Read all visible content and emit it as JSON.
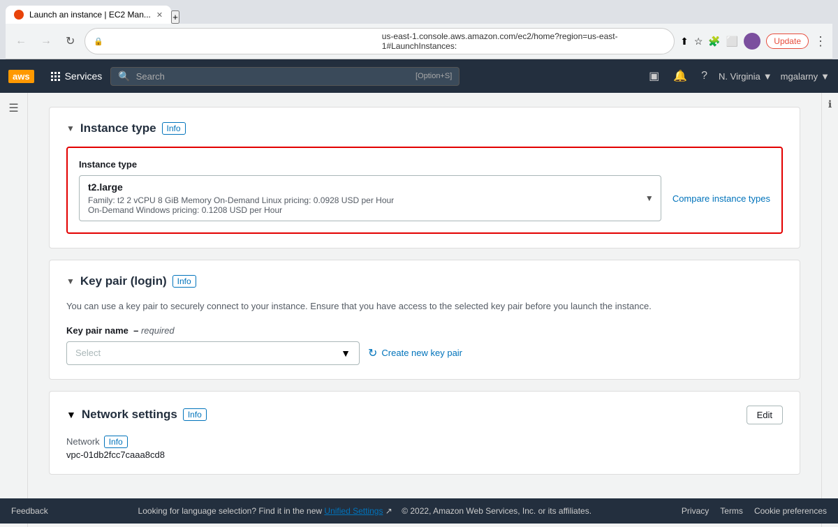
{
  "browser": {
    "tab_title": "Launch an instance | EC2 Man...",
    "new_tab_icon": "+",
    "address": "us-east-1.console.aws.amazon.com/ec2/home?region=us-east-1#LaunchInstances:",
    "update_label": "Update"
  },
  "aws_nav": {
    "logo": "aws",
    "services_label": "Services",
    "search_placeholder": "Search",
    "search_shortcut": "[Option+S]",
    "region": "N. Virginia",
    "user": "mgalarny"
  },
  "instance_type_section": {
    "title": "Instance type",
    "info_label": "Info",
    "field_label": "Instance type",
    "selected_instance": "t2.large",
    "instance_details": "Family: t2    2 vCPU    8 GiB Memory       On-Demand Linux pricing: 0.0928 USD per Hour",
    "instance_details2": "On-Demand Windows pricing: 0.1208 USD per Hour",
    "compare_link": "Compare instance types"
  },
  "key_pair_section": {
    "title": "Key pair (login)",
    "info_label": "Info",
    "description": "You can use a key pair to securely connect to your instance. Ensure that you have access to the selected key pair before you launch the instance.",
    "field_label": "Key pair name",
    "required_label": "required",
    "select_placeholder": "Select",
    "create_label": "Create new key pair"
  },
  "network_section": {
    "title": "Network settings",
    "info_label": "Info",
    "edit_label": "Edit",
    "network_label": "Network",
    "info_sub_label": "Info",
    "network_value": "vpc-01db2fcc7caaa8cd8"
  },
  "footer": {
    "feedback_label": "Feedback",
    "center_text": "Looking for language selection? Find it in the new",
    "unified_settings_label": "Unified Settings",
    "copyright": "© 2022, Amazon Web Services, Inc. or its affiliates.",
    "privacy_label": "Privacy",
    "terms_label": "Terms",
    "cookie_label": "Cookie preferences"
  }
}
